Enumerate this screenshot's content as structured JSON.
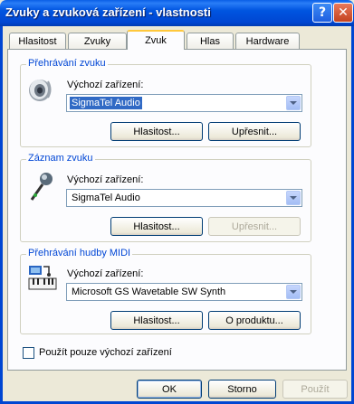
{
  "window": {
    "title": "Zvuky a zvuková zařízení - vlastnosti"
  },
  "titlebar": {
    "help_glyph": "?",
    "close_glyph": "✕"
  },
  "tabs": [
    {
      "label": "Hlasitost",
      "active": false
    },
    {
      "label": "Zvuky",
      "active": false
    },
    {
      "label": "Zvuk",
      "active": true
    },
    {
      "label": "Hlas",
      "active": false
    },
    {
      "label": "Hardware",
      "active": false
    }
  ],
  "playback": {
    "legend": "Přehrávání zvuku",
    "icon": "speaker-icon",
    "device_label": "Výchozí zařízení:",
    "device_value": "SigmaTel Audio",
    "volume_button": "Hlasitost...",
    "advanced_button": "Upřesnit...",
    "advanced_enabled": true
  },
  "recording": {
    "legend": "Záznam zvuku",
    "icon": "microphone-icon",
    "device_label": "Výchozí zařízení:",
    "device_value": "SigmaTel Audio",
    "volume_button": "Hlasitost...",
    "advanced_button": "Upřesnit...",
    "advanced_enabled": false
  },
  "midi": {
    "legend": "Přehrávání hudby MIDI",
    "icon": "midi-keyboard-icon",
    "device_label": "Výchozí zařízení:",
    "device_value": "Microsoft GS Wavetable SW Synth",
    "volume_button": "Hlasitost...",
    "about_button": "O produktu..."
  },
  "default_only": {
    "label": "Použít pouze výchozí zařízení",
    "checked": false
  },
  "footer": {
    "ok": "OK",
    "cancel": "Storno",
    "apply": "Použít",
    "apply_enabled": false
  },
  "colors": {
    "titlebar": "#0054e3",
    "selection": "#316ac5",
    "legend_text": "#0046d5",
    "dialog_bg": "#ece9d8"
  }
}
